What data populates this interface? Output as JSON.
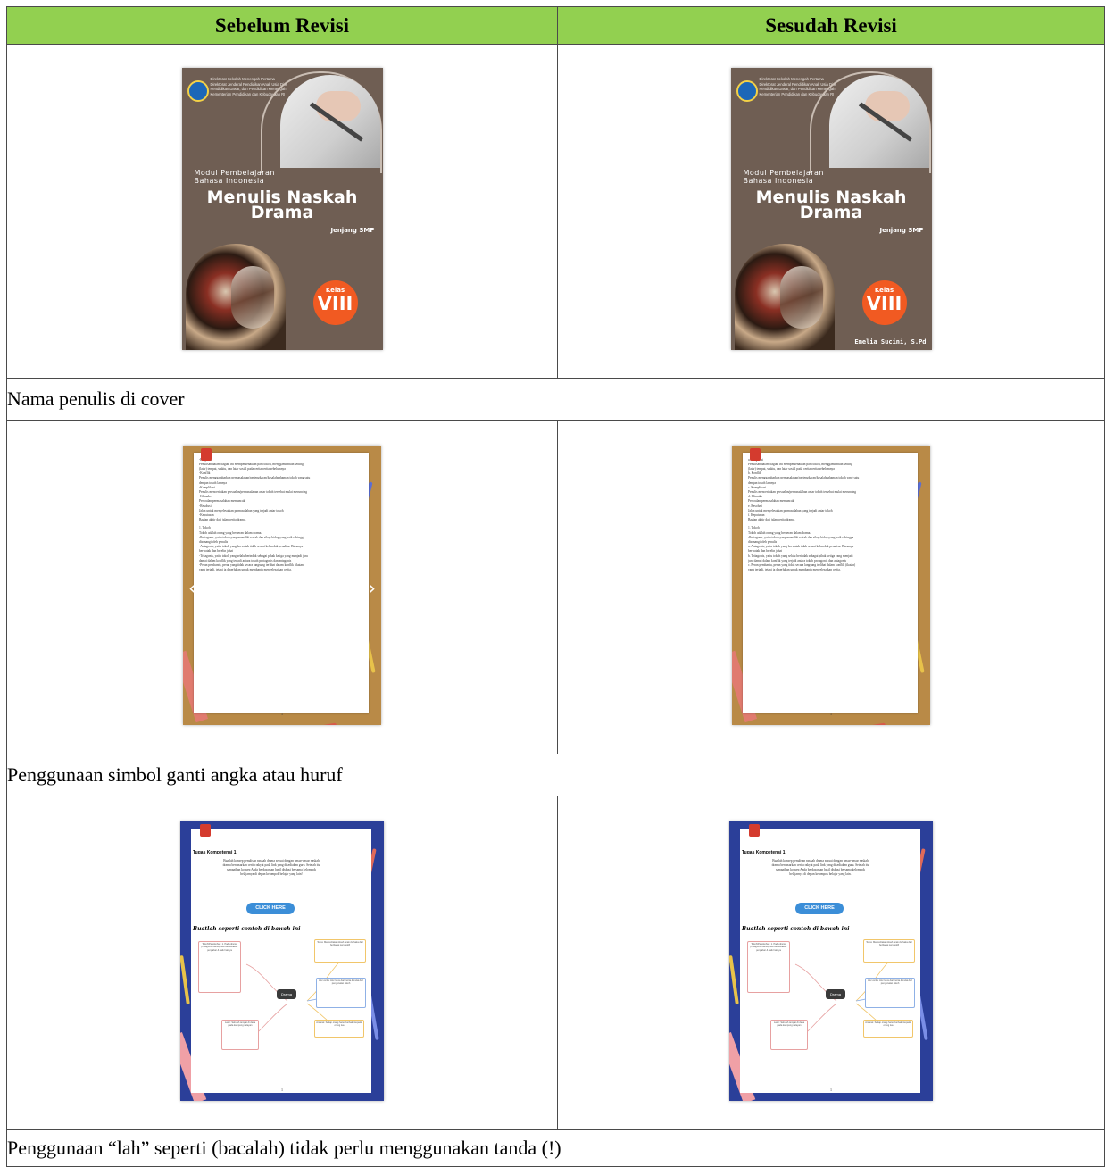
{
  "headers": {
    "before": "Sebelum Revisi",
    "after": "Sesudah Revisi"
  },
  "notes": [
    "Nama penulis di cover",
    "Penggunaan simbol ganti angka atau huruf",
    "Penggunaan “lah” seperti (bacalah) tidak perlu menggunakan tanda (!)"
  ],
  "cover": {
    "institution": [
      "Direktorat Sekolah Menengah Pertama",
      "Direktorat Jenderal Pendidikan Anak Usia Dini",
      "Pendidikan Dasar, dan Pendidikan Menengah",
      "Kementerian Pendidikan dan Kebudayaan RI"
    ],
    "subtitle_line1": "Modul Pembelajaran",
    "subtitle_line2": "Bahasa Indonesia",
    "title_line1": "Menulis Naskah",
    "title_line2": "Drama",
    "level": "Jenjang SMP",
    "class_label": "Kelas",
    "class_number": "VIII",
    "author_after": "Emelia Sucini, S.Pd"
  },
  "text_page_before": [
    "-Eksposisi",
    "Penulisan dalam bagian ini memperkenalkan para tokoh, menggambarkan setting",
    "(latar) tempat, waktu, dan latar sosial pada cerita cerita sebelumnya",
    "-Konflik",
    "Penulis menggambarkan permasalahan/pertengkaran/kesalahpahaman tokoh yang satu",
    "dengan tokoh lainnya",
    "-Komplikasi",
    "Penulis menceritakan persoalan/permasalahan antar tokoh tersebut mulai meruncing",
    "-Klimaks",
    "Persoalan/permasalahan memuncak",
    "-Resolusi",
    "Jalan untuk menyelesaikan permasalahan yang terjadi antar tokoh",
    "-Keputusan",
    "Bagian akhir dari jalan cerita drama.",
    "",
    "1. Tokoh",
    "Tokoh adalah orang yang berperan dalam drama.",
    "-Protagonis, yaitu tokoh yang memiliki watak dan sikap hidup yang baik sehingga",
    "disenangi oleh penulis",
    "-Antagonis, yaitu tokoh yang berwatak tidak sesuai kehendak penulisa. Biasanya",
    "berwatak dan berelin jahat",
    "-Tritagonis, yaitu tokoh yang selalu berindak sebagai pihak ketiga yang menjadi juru",
    "damai dalam konflik yang terjadi antara tokoh protagonis dan antagonis",
    "-Peran pembantu, peran yang tidak secara langsung terlibat dalam konflik (ikatan)",
    "yang terjadi, tetapi ia diperlukan untuk membantu menyelesaikan cerita."
  ],
  "text_page_after": [
    "a. Eksposisi",
    "Penulisan dalam bagian ini memperkenalkan para tokoh, menggambarkan setting",
    "(latar) tempat, waktu, dan latar sosial pada cerita cerita sebelumnya",
    "b. Konflik",
    "Penulis menggambarkan permasalahan/pertengkaran/kesalahpahaman tokoh yang satu",
    "dengan tokoh lainnya",
    "c. Komplikasi",
    "Penulis menceritakan persoalan/permasalahan antar tokoh tersebut mulai meruncing",
    "d. Klimaks",
    "Persoalan/permasalahan memuncak",
    "e. Resolusi",
    "Jalan untuk menyelesaikan permasalahan yang terjadi antar tokoh",
    "f. Keputusan",
    "Bagian akhir dari jalan cerita drama.",
    "",
    "1. Tokoh",
    "Tokoh adalah orang yang berperan dalam drama.",
    "-Protagonis, yaitu tokoh yang memiliki watak dan sikap hidup yang baik sehingga",
    "disenangi oleh penulis",
    "a. Antagonis, yaitu tokoh yang berwatak tidak sesuai kehendak penulisa. Biasanya",
    "berwatak dan berelin jahat",
    "b. Tritagonis, yaitu tokoh yang selalu berindak sebagai pihak ketiga yang menjadi",
    "juru damai dalam konflik yang terjadi antara tokoh protagonis dan antagonis",
    "c. Peran pembantu, peran yang tidak secara langsung terlibat dalam konflik (ikatan)",
    "yang terjadi, tetapi ia diperlukan untuk membantu menyelesaikan cerita."
  ],
  "task_page": {
    "heading": "Tugas Kompetensi 1",
    "para_before": [
      "Buatlah konsep penulisan naskah drama sesuai dengan unsur-unsur naskah",
      "drama berdasarkan cerita rakyat pada link yang disediakan guru. Setelah itu",
      "sampaikan konsep Anda berdasarkan hasil diskusi bersama kelompok",
      "belajarnya di depan kelompok belajar yang lain!"
    ],
    "para_after": [
      "Buatlah konsep penulisan naskah drama sesuai dengan unsur-unsur naskah",
      "drama berdasarkan cerita rakyat pada link yang disediakan guru. Setelah itu",
      "sampaikan konsep Anda berdasarkan hasil diskusi bersama kelompok",
      "belajarnya di depan kelompok belajar yang lain."
    ],
    "button": "CLICK HERE",
    "script_line": "Buatlah seperti contoh di bawah ini",
    "hub": "Drama",
    "box_a": "Tokoh/Penokohan: 1. Pada drama protagonis utama, memiliki karakter penyabar & baik hatinya",
    "box_b": "Tema: Menceritakan kisah anak durhaka dari berbagai perspektif",
    "box_c": "Alur cerita: Alur lurus dari cerita dimulai dari pengenalan tokoh",
    "box_d": "Latar: Sebuah tempat di desa pada kampung nelayan",
    "box_e": "Amanat: Setiap orang harus berbakti kepada orang tua"
  }
}
